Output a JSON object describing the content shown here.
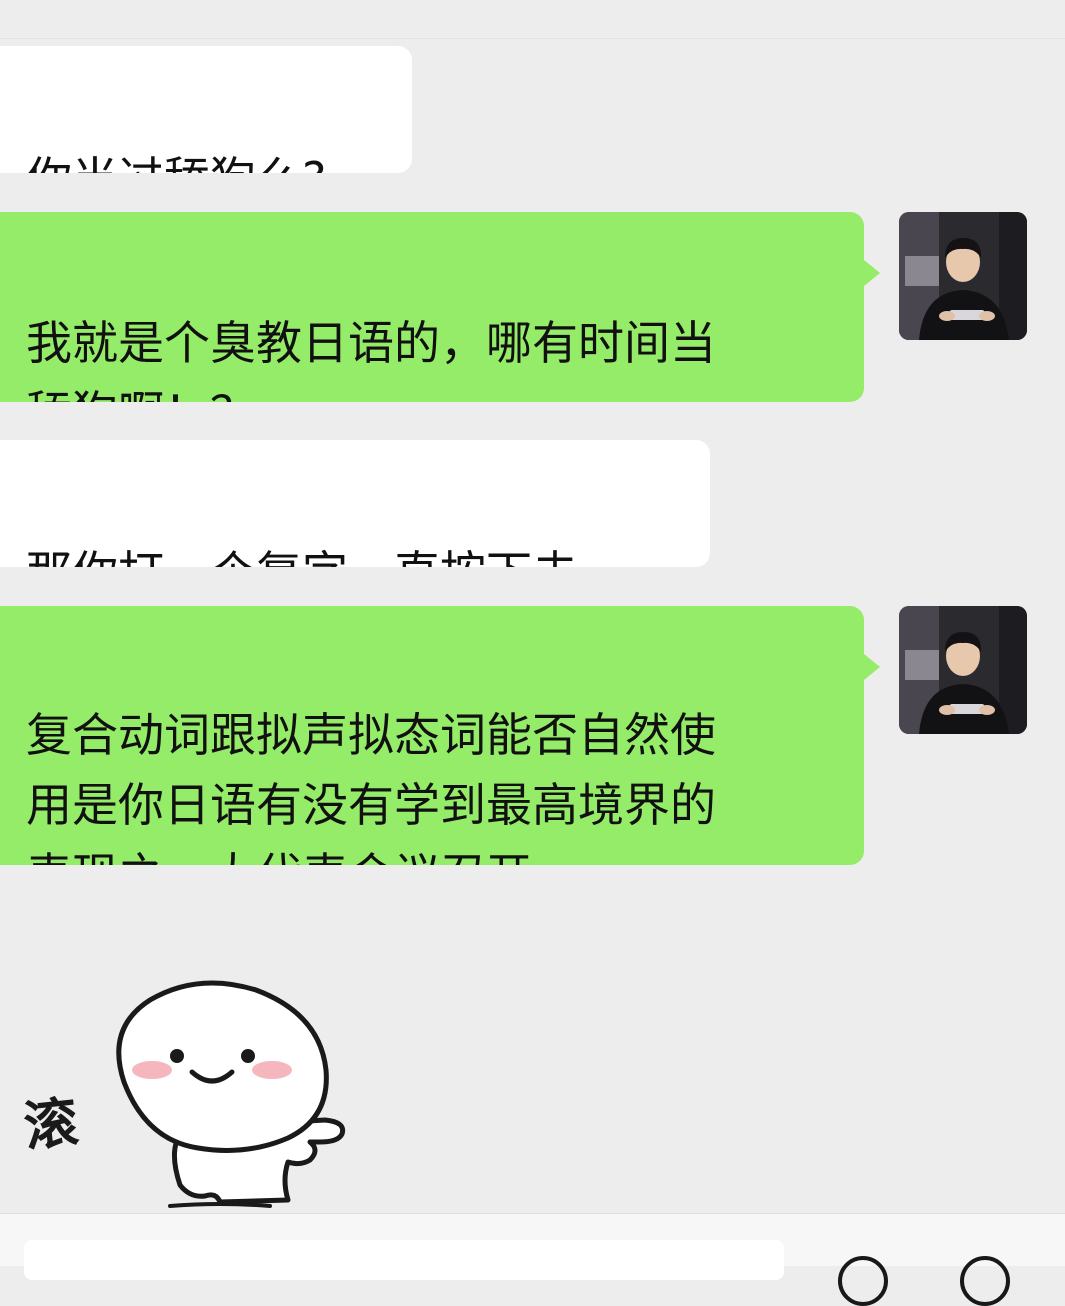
{
  "messages": [
    {
      "side": "left",
      "text": "你当过舔狗么?"
    },
    {
      "side": "right",
      "text": "我就是个臭教日语的，哪有时间当\n舔狗啊！？"
    },
    {
      "side": "left",
      "text": "那你打一个复字一直按下去"
    },
    {
      "side": "right",
      "text": "复合动词跟拟声拟态词能否自然使\n用是你日语有没有学到最高境界的\n表现之一大代表会议召开"
    }
  ],
  "sticker": {
    "caption": "滚",
    "icon": "white-blob-pointing-sticker"
  },
  "input_bar": {
    "placeholder": "",
    "icons": [
      "emoji-icon",
      "plus-icon"
    ]
  },
  "colors": {
    "background": "#ededed",
    "incoming_bubble": "#ffffff",
    "outgoing_bubble": "#95ec69",
    "text": "#111111"
  }
}
